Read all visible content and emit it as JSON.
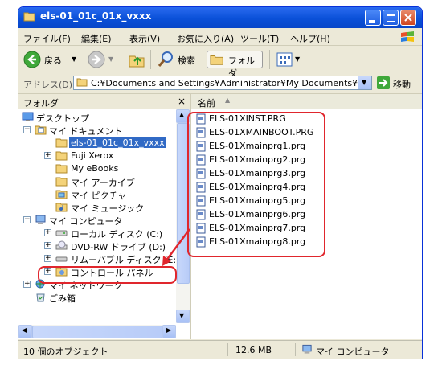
{
  "window": {
    "title": "els-01_01c_01x_vxxx"
  },
  "menu": {
    "items": [
      "ファイル(F)",
      "編集(E)",
      "表示(V)",
      "お気に入り(A)",
      "ツール(T)",
      "ヘルプ(H)"
    ]
  },
  "toolbar": {
    "back_label": "戻る",
    "search_label": "検索",
    "folders_label": "フォルダ"
  },
  "address": {
    "label": "アドレス(D)",
    "path": "C:¥Documents and Settings¥Administrator¥My Documents¥ELS",
    "go_label": "移動"
  },
  "folder_pane": {
    "title": "フォルダ",
    "close": "×",
    "tree": [
      {
        "label": "デスクトップ",
        "icon": "desktop-icon"
      },
      {
        "label": "マイ ドキュメント",
        "icon": "my-documents-icon"
      },
      {
        "label": "els-01_01c_01x_vxxx",
        "icon": "folder-open-icon",
        "selected": true
      },
      {
        "label": "Fuji Xerox",
        "icon": "folder-icon"
      },
      {
        "label": "My eBooks",
        "icon": "folder-icon"
      },
      {
        "label": "マイ アーカイブ",
        "icon": "folder-icon"
      },
      {
        "label": "マイ ピクチャ",
        "icon": "pictures-icon"
      },
      {
        "label": "マイ ミュージック",
        "icon": "music-icon"
      },
      {
        "label": "マイ コンピュータ",
        "icon": "my-computer-icon"
      },
      {
        "label": "ローカル ディスク (C:)",
        "icon": "hard-disk-icon"
      },
      {
        "label": "DVD-RW ドライブ (D:)",
        "icon": "dvd-drive-icon"
      },
      {
        "label": "リムーバブル ディスク (E:)",
        "icon": "removable-disk-icon"
      },
      {
        "label": "コントロール パネル",
        "icon": "control-panel-icon"
      },
      {
        "label": "マイ ネットワーク",
        "icon": "network-icon"
      },
      {
        "label": "ごみ箱",
        "icon": "recycle-bin-icon"
      }
    ]
  },
  "file_pane": {
    "column_name": "名前",
    "files": [
      "ELS-01XINST.PRG",
      "ELS-01XMAINBOOT.PRG",
      "ELS-01Xmainprg1.prg",
      "ELS-01Xmainprg2.prg",
      "ELS-01Xmainprg3.prg",
      "ELS-01Xmainprg4.prg",
      "ELS-01Xmainprg5.prg",
      "ELS-01Xmainprg6.prg",
      "ELS-01Xmainprg7.prg",
      "ELS-01Xmainprg8.prg"
    ]
  },
  "status": {
    "count": "10 個のオブジェクト",
    "size": "12.6 MB",
    "location": "マイ コンピュータ"
  },
  "colors": {
    "highlight": "#e0262d",
    "selection": "#316ac5",
    "titlebar": "#0a50d8"
  }
}
